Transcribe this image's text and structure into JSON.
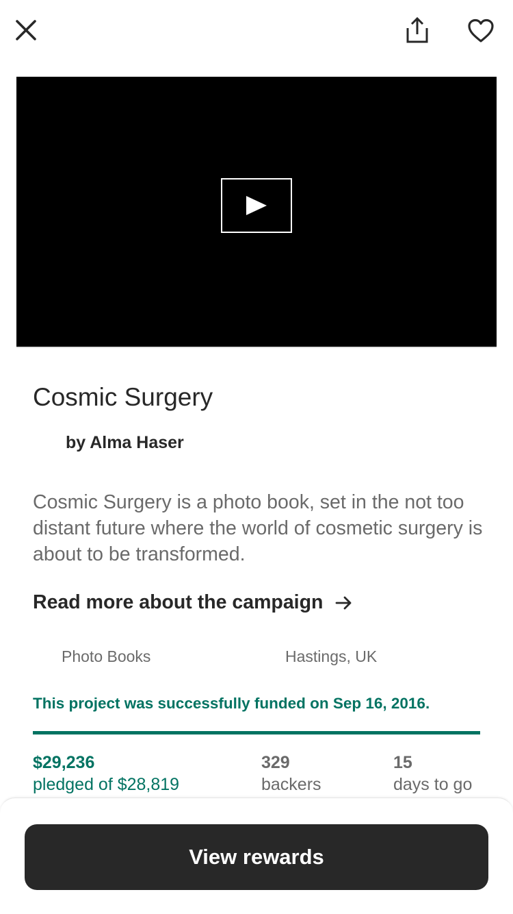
{
  "header": {
    "close_icon": "close-icon",
    "share_icon": "share-icon",
    "heart_icon": "heart-icon"
  },
  "video": {
    "play_icon": "play-icon"
  },
  "project": {
    "title": "Cosmic Surgery",
    "creator": "by Alma Haser",
    "blurb": "Cosmic Surgery is a photo book, set in the not too distant future where the world of cosmetic surgery is about to be transformed.",
    "read_more": "Read more about the campaign",
    "category": "Photo Books",
    "location": "Hastings, UK",
    "funded_message": "This project was successfully funded on Sep 16, 2016."
  },
  "stats": {
    "progress_percent": 100,
    "pledged_amount": "$29,236",
    "pledged_label": "pledged of $28,819",
    "backers_count": "329",
    "backers_label": "backers",
    "days_count": "15",
    "days_label": "days to go"
  },
  "cta": {
    "label": "View rewards"
  },
  "colors": {
    "accent_green": "#037362",
    "dark": "#282828",
    "muted": "#6a6a6a"
  }
}
